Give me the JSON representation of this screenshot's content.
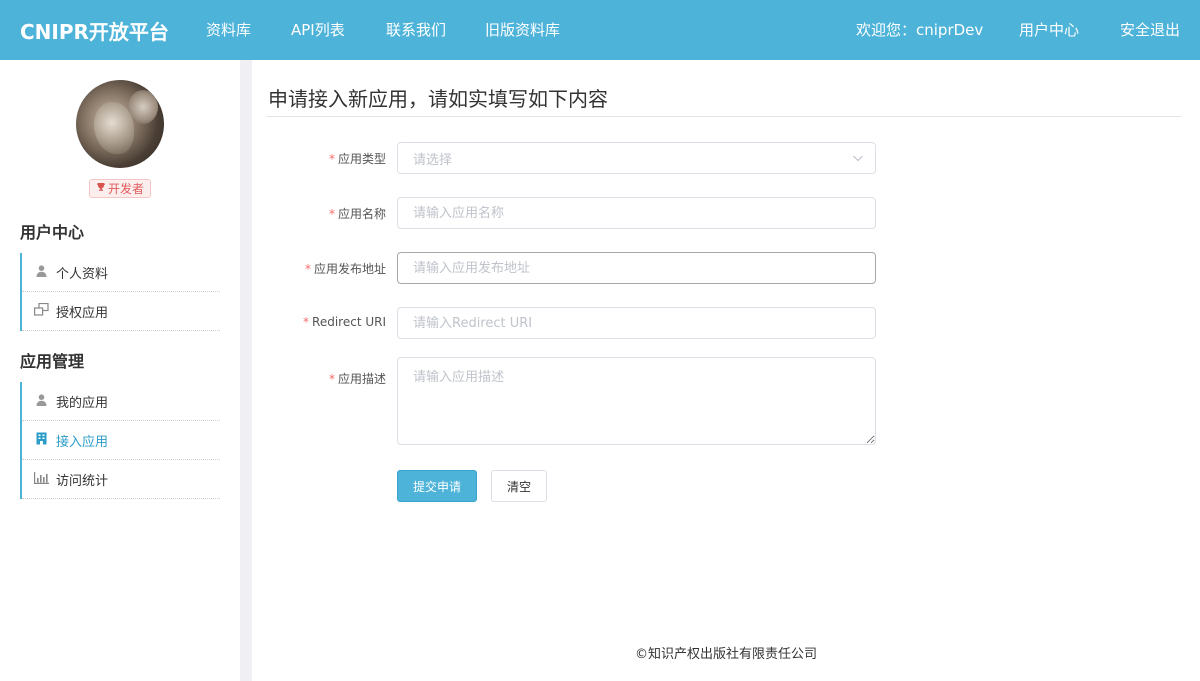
{
  "header": {
    "brand": "CNIPR开放平台",
    "nav": [
      {
        "label": "资料库"
      },
      {
        "label": "API列表"
      },
      {
        "label": "联系我们"
      },
      {
        "label": "旧版资料库"
      }
    ],
    "welcome": "欢迎您：cniprDev",
    "user_center": "用户中心",
    "logout": "安全退出"
  },
  "sidebar": {
    "badge": "开发者",
    "sections": [
      {
        "title": "用户中心",
        "items": [
          {
            "label": "个人资料",
            "icon": "user-icon"
          },
          {
            "label": "授权应用",
            "icon": "windows-icon"
          }
        ]
      },
      {
        "title": "应用管理",
        "items": [
          {
            "label": "我的应用",
            "icon": "user-icon"
          },
          {
            "label": "接入应用",
            "icon": "building-icon",
            "active": true
          },
          {
            "label": "访问统计",
            "icon": "bar-chart-icon"
          }
        ]
      }
    ]
  },
  "main": {
    "title": "申请接入新应用，请如实填写如下内容",
    "form": {
      "app_type": {
        "label": "应用类型",
        "placeholder": "请选择"
      },
      "app_name": {
        "label": "应用名称",
        "placeholder": "请输入应用名称"
      },
      "app_url": {
        "label": "应用发布地址",
        "placeholder": "请输入应用发布地址"
      },
      "redirect_uri": {
        "label": "Redirect URI",
        "placeholder": "请输入Redirect URI"
      },
      "app_desc": {
        "label": "应用描述",
        "placeholder": "请输入应用描述"
      },
      "submit_label": "提交申请",
      "clear_label": "清空"
    }
  },
  "footer": {
    "text": "©知识产权出版社有限责任公司"
  },
  "colors": {
    "accent": "#4db3d9",
    "required": "#f56c6c",
    "active_menu": "#2b9cc7"
  }
}
